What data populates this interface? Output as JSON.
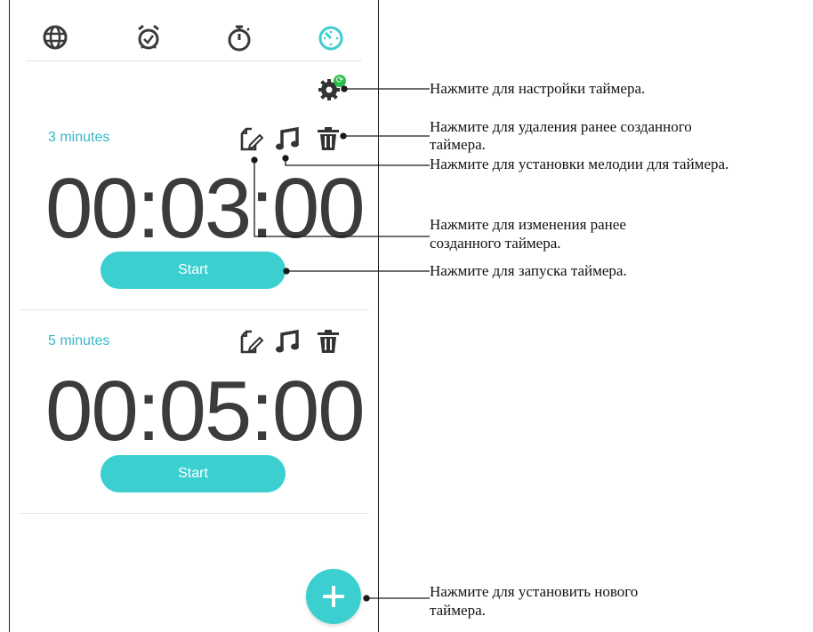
{
  "tabs": [
    {
      "icon": "globe-icon"
    },
    {
      "icon": "alarm-clock-icon"
    },
    {
      "icon": "stopwatch-icon"
    },
    {
      "icon": "timer-icon",
      "active": true
    }
  ],
  "colors": {
    "accent": "#3ccfd0",
    "label": "#35b9c6",
    "text": "#3b3b3b",
    "badge": "#2bbf4e"
  },
  "timers": [
    {
      "label": "3 minutes",
      "time": "00:03:00",
      "start_label": "Start"
    },
    {
      "label": "5 minutes",
      "time": "00:05:00",
      "start_label": "Start"
    }
  ],
  "callouts": {
    "settings": "Нажмите для настройки таймера.",
    "delete_line1": "Нажмите для удаления ранее созданного",
    "delete_line2": "таймера.",
    "ringtone": "Нажмите для установки мелодии для таймера.",
    "edit_line1": "Нажмите для изменения ранее",
    "edit_line2": "созданного таймера.",
    "start": "Нажмите для запуска таймера.",
    "add_line1": "Нажмите для установить нового",
    "add_line2": "таймера."
  }
}
